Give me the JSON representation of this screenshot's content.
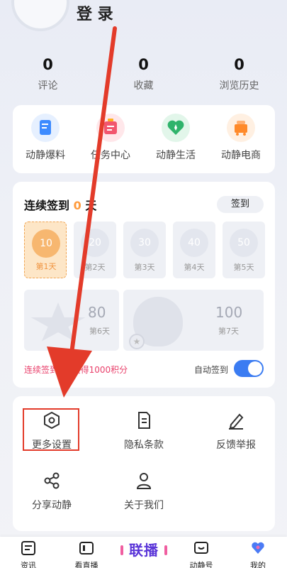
{
  "header": {
    "login_text": "登 录"
  },
  "stats": [
    {
      "value": "0",
      "label": "评论"
    },
    {
      "value": "0",
      "label": "收藏"
    },
    {
      "value": "0",
      "label": "浏览历史"
    }
  ],
  "quick_links": [
    {
      "label": "动静爆料",
      "icon": "news-report-icon",
      "color": "#3d8bff"
    },
    {
      "label": "任务中心",
      "icon": "task-center-icon",
      "color": "#f2566e"
    },
    {
      "label": "动静生活",
      "icon": "life-heart-icon",
      "color": "#2fb36b"
    },
    {
      "label": "动静电商",
      "icon": "shop-cart-icon",
      "color": "#ff8a2a"
    }
  ],
  "signin": {
    "title_prefix": "连续签到",
    "count": "0",
    "title_suffix": "天",
    "button": "签到",
    "days": [
      {
        "coins": "10",
        "label": "第1天"
      },
      {
        "coins": "20",
        "label": "第2天"
      },
      {
        "coins": "30",
        "label": "第3天"
      },
      {
        "coins": "40",
        "label": "第4天"
      },
      {
        "coins": "50",
        "label": "第5天"
      },
      {
        "coins": "80",
        "label": "第6天"
      },
      {
        "coins": "100",
        "label": "第7天"
      }
    ],
    "note": "连续签到7天获得1000积分",
    "auto_label": "自动签到",
    "auto_enabled": true
  },
  "menu": [
    {
      "label": "更多设置",
      "icon": "hexagon-settings-icon"
    },
    {
      "label": "隐私条款",
      "icon": "document-icon"
    },
    {
      "label": "反馈举报",
      "icon": "pen-edit-icon"
    },
    {
      "label": "分享动静",
      "icon": "share-icon"
    },
    {
      "label": "关于我们",
      "icon": "user-icon"
    }
  ],
  "tabbar": {
    "items": [
      {
        "label": "资讯",
        "icon": "news-icon"
      },
      {
        "label": "看直播",
        "icon": "live-tv-icon"
      },
      {
        "label": "动静号",
        "icon": "account-tv-icon"
      },
      {
        "label": "我的",
        "icon": "profile-icon"
      }
    ],
    "center_label": "联播"
  },
  "colors": {
    "accent": "#3b7cf2",
    "annotation": "#e33b2a",
    "signin_orange": "#f7b770"
  }
}
